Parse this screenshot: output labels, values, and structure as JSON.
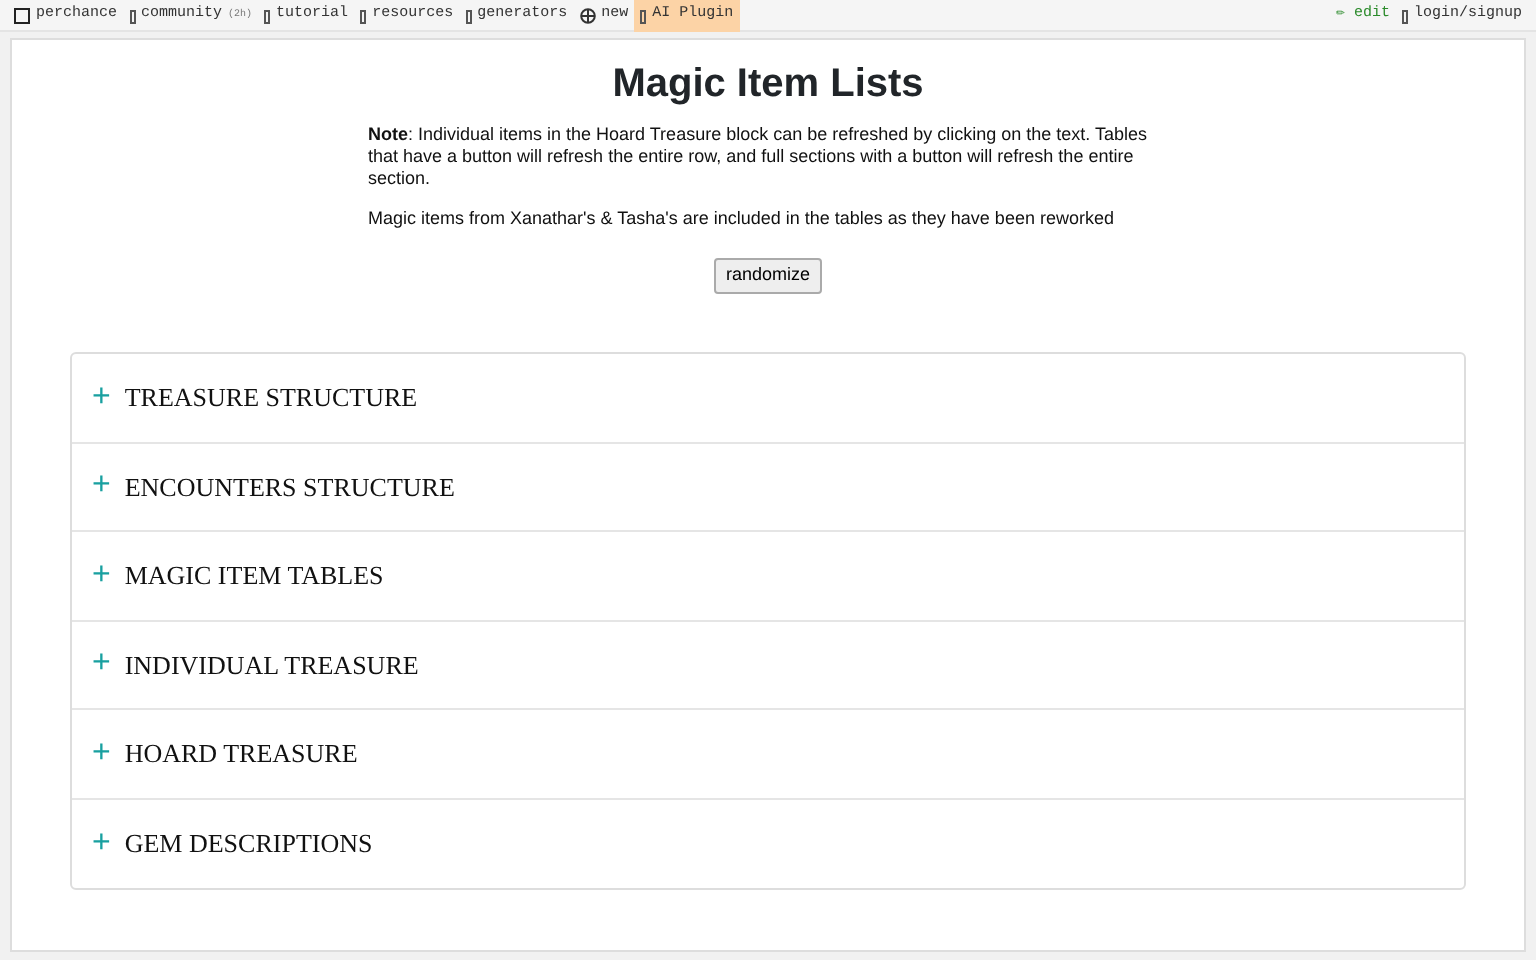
{
  "topbar": {
    "left": [
      {
        "kind": "logo",
        "label": "perchance",
        "highlighted": false
      },
      {
        "kind": "glyph",
        "label": "community",
        "suffix": "(2h)",
        "highlighted": false
      },
      {
        "kind": "glyph",
        "label": "tutorial",
        "highlighted": false
      },
      {
        "kind": "glyph",
        "label": "resources",
        "highlighted": false
      },
      {
        "kind": "glyph",
        "label": "generators",
        "highlighted": false
      },
      {
        "kind": "plus",
        "label": "new",
        "highlighted": false
      },
      {
        "kind": "glyph",
        "label": "AI Plugin",
        "highlighted": true
      }
    ],
    "right": [
      {
        "kind": "edit",
        "label": "✏ edit",
        "highlighted": false
      },
      {
        "kind": "glyph",
        "label": "login/signup",
        "highlighted": false
      }
    ]
  },
  "title": "Magic Item Lists",
  "notes": [
    "**Note**: Individual items in the Hoard Treasure block can be refreshed by clicking on the text. Tables that have a button will refresh the entire row, and full sections with a button will refresh the entire section.",
    "Magic items from Xanathar's & Tasha's are included in the tables as they have been reworked"
  ],
  "button": "randomize",
  "sections": [
    {
      "icon": "+",
      "label": "TREASURE STRUCTURE",
      "expanded": false
    },
    {
      "icon": "+",
      "label": "ENCOUNTERS STRUCTURE",
      "expanded": false
    },
    {
      "icon": "+",
      "label": "MAGIC ITEM TABLES",
      "expanded": false
    },
    {
      "icon": "+",
      "label": "INDIVIDUAL TREASURE",
      "expanded": false
    },
    {
      "icon": "+",
      "label": "HOARD TREASURE",
      "expanded": false
    },
    {
      "icon": "+",
      "label": "GEM DESCRIPTIONS",
      "expanded": false
    }
  ]
}
